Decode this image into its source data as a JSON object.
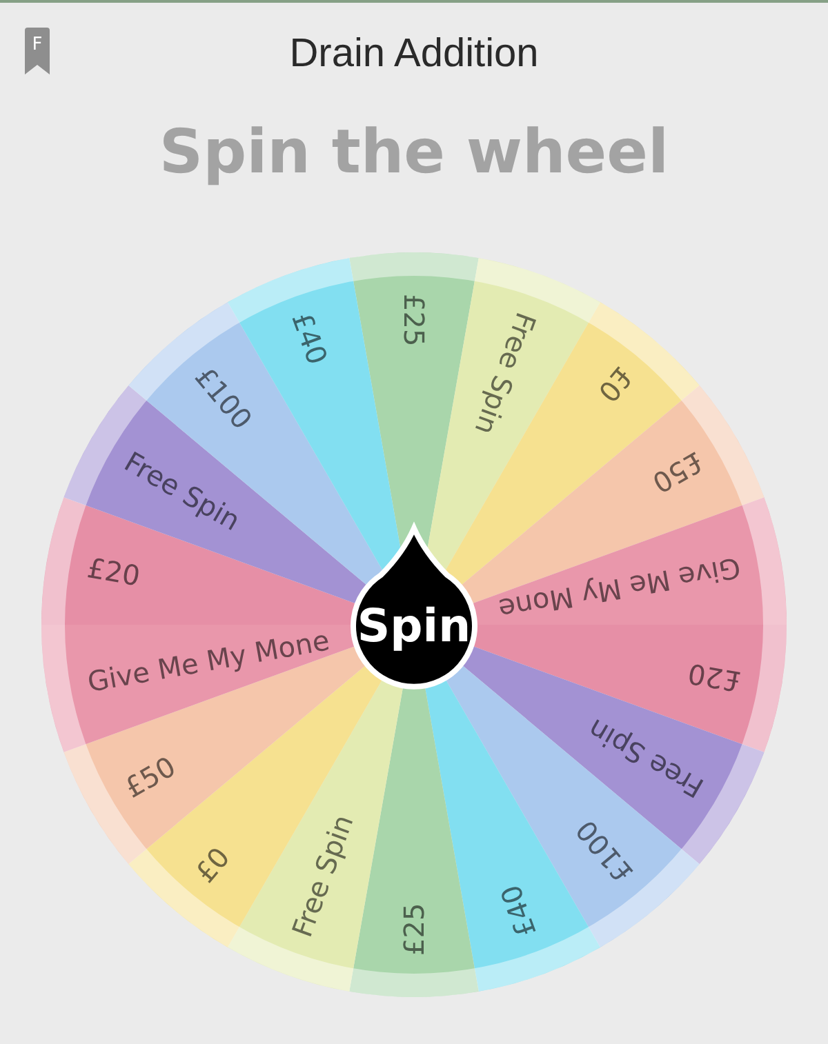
{
  "header": {
    "title": "Drain Addition",
    "badge": "F"
  },
  "heading": "Spin the wheel",
  "wheel": {
    "button": "Spin",
    "segments": [
      {
        "label": "£25",
        "color": "#a9d6ab"
      },
      {
        "label": "Free Spin",
        "color": "#e3ebb2"
      },
      {
        "label": "£0",
        "color": "#f6e190"
      },
      {
        "label": "£50",
        "color": "#f5c6ab"
      },
      {
        "label": "Give Me My Mone",
        "color": "#e997ab"
      },
      {
        "label": "£20",
        "color": "#e68fa6"
      },
      {
        "label": "Free Spin",
        "color": "#a392d3"
      },
      {
        "label": "£100",
        "color": "#abc9ee"
      },
      {
        "label": "£40",
        "color": "#82dff1"
      },
      {
        "label": "£25",
        "color": "#a9d6ab"
      },
      {
        "label": "Free Spin",
        "color": "#e3ebb2"
      },
      {
        "label": "£0",
        "color": "#f6e190"
      },
      {
        "label": "£50",
        "color": "#f5c6ab"
      },
      {
        "label": "Give Me My Mone",
        "color": "#e997ab"
      },
      {
        "label": "£20",
        "color": "#e68fa6"
      },
      {
        "label": "Free Spin",
        "color": "#a392d3"
      },
      {
        "label": "£100",
        "color": "#abc9ee"
      },
      {
        "label": "£40",
        "color": "#82dff1"
      }
    ]
  }
}
